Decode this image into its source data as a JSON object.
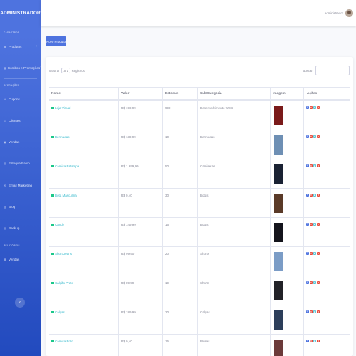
{
  "sidebar": {
    "brand": "ADMINISTRADOR",
    "heading_cadastros": "CADASTROS",
    "heading_operacoes": "OPERAÇÕES",
    "heading_relatorios": "RELATÓRIOS",
    "items": [
      {
        "label": "Produtos",
        "icon": "box-icon"
      },
      {
        "label": "Combos e Promoções",
        "icon": "tags-icon"
      },
      {
        "label": "Cupons",
        "icon": "percent-icon"
      },
      {
        "label": "Clientes",
        "icon": "users-icon"
      },
      {
        "label": "Vendas",
        "icon": "cart-icon"
      },
      {
        "label": "Estoque Baixo",
        "icon": "alert-icon"
      },
      {
        "label": "Email Marketing",
        "icon": "mail-icon"
      },
      {
        "label": "Blog",
        "icon": "blog-icon"
      },
      {
        "label": "Backup",
        "icon": "database-icon"
      },
      {
        "label": "Vendas",
        "icon": "chart-icon"
      }
    ],
    "toggle_icon": "‹"
  },
  "topbar": {
    "user_name": "Administrador"
  },
  "new_button": "Novo Produto",
  "table_controls": {
    "show_label": "Mostrar",
    "page_length": "10",
    "records_label": "Registros",
    "search_label": "Buscar:"
  },
  "columns": [
    "Nome",
    "Valor",
    "Estoque",
    "SubCategoria",
    "Imagem",
    "Ações"
  ],
  "rows": [
    {
      "name": "Loja Virtual",
      "price": "R$ 199,99",
      "stock": "999",
      "subcategory": "Desenvolvimento WEB",
      "thumb_color": "#7a1a1a"
    },
    {
      "name": "Bermudas",
      "price": "R$ 139,99",
      "stock": "10",
      "subcategory": "Bermudas",
      "thumb_color": "#6e8fb4"
    },
    {
      "name": "Camisa Estampa",
      "price": "R$ 1.699,99",
      "stock": "50",
      "subcategory": "Camisetas",
      "thumb_color": "#1a2233"
    },
    {
      "name": "Bota Masculina",
      "price": "R$ 0,40",
      "stock": "30",
      "subcategory": "Botas",
      "thumb_color": "#5a3a28"
    },
    {
      "name": "Cândy",
      "price": "R$ 149,99",
      "stock": "16",
      "subcategory": "Botas",
      "thumb_color": "#14141c"
    },
    {
      "name": "Short Jeans",
      "price": "R$ 99,90",
      "stock": "20",
      "subcategory": "Shorts",
      "thumb_color": "#7b9cc6"
    },
    {
      "name": "Calção Preto",
      "price": "R$ 89,99",
      "stock": "19",
      "subcategory": "Shorts",
      "thumb_color": "#222228"
    },
    {
      "name": "Calças",
      "price": "R$ 189,99",
      "stock": "20",
      "subcategory": "Calças",
      "thumb_color": "#2c3e5a"
    },
    {
      "name": "Camisa Polo",
      "price": "R$ 0,40",
      "stock": "16",
      "subcategory": "Blusas",
      "thumb_color": "#6b3a3a"
    }
  ],
  "action_colors": {
    "edit": "#4e73df",
    "delete": "#e74a3b",
    "image": "#36b9cc",
    "promo": "#e74a3b"
  }
}
